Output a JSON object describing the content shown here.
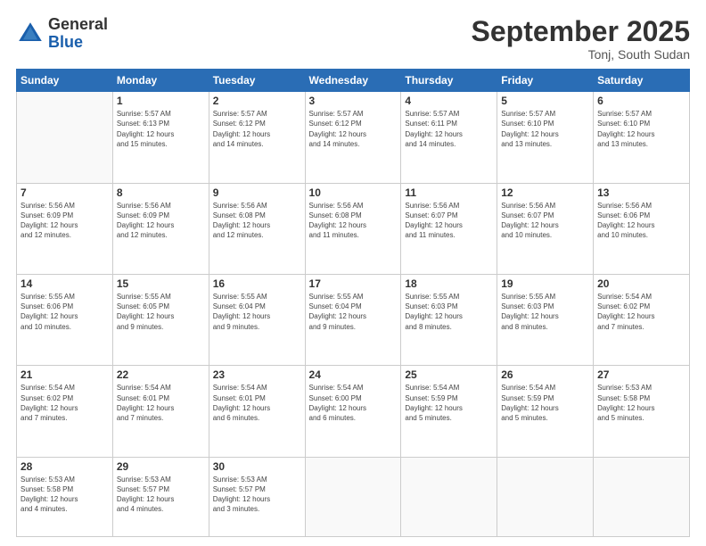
{
  "header": {
    "logo_general": "General",
    "logo_blue": "Blue",
    "title": "September 2025",
    "subtitle": "Tonj, South Sudan"
  },
  "weekdays": [
    "Sunday",
    "Monday",
    "Tuesday",
    "Wednesday",
    "Thursday",
    "Friday",
    "Saturday"
  ],
  "weeks": [
    [
      {
        "day": "",
        "info": ""
      },
      {
        "day": "1",
        "info": "Sunrise: 5:57 AM\nSunset: 6:13 PM\nDaylight: 12 hours\nand 15 minutes."
      },
      {
        "day": "2",
        "info": "Sunrise: 5:57 AM\nSunset: 6:12 PM\nDaylight: 12 hours\nand 14 minutes."
      },
      {
        "day": "3",
        "info": "Sunrise: 5:57 AM\nSunset: 6:12 PM\nDaylight: 12 hours\nand 14 minutes."
      },
      {
        "day": "4",
        "info": "Sunrise: 5:57 AM\nSunset: 6:11 PM\nDaylight: 12 hours\nand 14 minutes."
      },
      {
        "day": "5",
        "info": "Sunrise: 5:57 AM\nSunset: 6:10 PM\nDaylight: 12 hours\nand 13 minutes."
      },
      {
        "day": "6",
        "info": "Sunrise: 5:57 AM\nSunset: 6:10 PM\nDaylight: 12 hours\nand 13 minutes."
      }
    ],
    [
      {
        "day": "7",
        "info": "Sunrise: 5:56 AM\nSunset: 6:09 PM\nDaylight: 12 hours\nand 12 minutes."
      },
      {
        "day": "8",
        "info": "Sunrise: 5:56 AM\nSunset: 6:09 PM\nDaylight: 12 hours\nand 12 minutes."
      },
      {
        "day": "9",
        "info": "Sunrise: 5:56 AM\nSunset: 6:08 PM\nDaylight: 12 hours\nand 12 minutes."
      },
      {
        "day": "10",
        "info": "Sunrise: 5:56 AM\nSunset: 6:08 PM\nDaylight: 12 hours\nand 11 minutes."
      },
      {
        "day": "11",
        "info": "Sunrise: 5:56 AM\nSunset: 6:07 PM\nDaylight: 12 hours\nand 11 minutes."
      },
      {
        "day": "12",
        "info": "Sunrise: 5:56 AM\nSunset: 6:07 PM\nDaylight: 12 hours\nand 10 minutes."
      },
      {
        "day": "13",
        "info": "Sunrise: 5:56 AM\nSunset: 6:06 PM\nDaylight: 12 hours\nand 10 minutes."
      }
    ],
    [
      {
        "day": "14",
        "info": "Sunrise: 5:55 AM\nSunset: 6:06 PM\nDaylight: 12 hours\nand 10 minutes."
      },
      {
        "day": "15",
        "info": "Sunrise: 5:55 AM\nSunset: 6:05 PM\nDaylight: 12 hours\nand 9 minutes."
      },
      {
        "day": "16",
        "info": "Sunrise: 5:55 AM\nSunset: 6:04 PM\nDaylight: 12 hours\nand 9 minutes."
      },
      {
        "day": "17",
        "info": "Sunrise: 5:55 AM\nSunset: 6:04 PM\nDaylight: 12 hours\nand 9 minutes."
      },
      {
        "day": "18",
        "info": "Sunrise: 5:55 AM\nSunset: 6:03 PM\nDaylight: 12 hours\nand 8 minutes."
      },
      {
        "day": "19",
        "info": "Sunrise: 5:55 AM\nSunset: 6:03 PM\nDaylight: 12 hours\nand 8 minutes."
      },
      {
        "day": "20",
        "info": "Sunrise: 5:54 AM\nSunset: 6:02 PM\nDaylight: 12 hours\nand 7 minutes."
      }
    ],
    [
      {
        "day": "21",
        "info": "Sunrise: 5:54 AM\nSunset: 6:02 PM\nDaylight: 12 hours\nand 7 minutes."
      },
      {
        "day": "22",
        "info": "Sunrise: 5:54 AM\nSunset: 6:01 PM\nDaylight: 12 hours\nand 7 minutes."
      },
      {
        "day": "23",
        "info": "Sunrise: 5:54 AM\nSunset: 6:01 PM\nDaylight: 12 hours\nand 6 minutes."
      },
      {
        "day": "24",
        "info": "Sunrise: 5:54 AM\nSunset: 6:00 PM\nDaylight: 12 hours\nand 6 minutes."
      },
      {
        "day": "25",
        "info": "Sunrise: 5:54 AM\nSunset: 5:59 PM\nDaylight: 12 hours\nand 5 minutes."
      },
      {
        "day": "26",
        "info": "Sunrise: 5:54 AM\nSunset: 5:59 PM\nDaylight: 12 hours\nand 5 minutes."
      },
      {
        "day": "27",
        "info": "Sunrise: 5:53 AM\nSunset: 5:58 PM\nDaylight: 12 hours\nand 5 minutes."
      }
    ],
    [
      {
        "day": "28",
        "info": "Sunrise: 5:53 AM\nSunset: 5:58 PM\nDaylight: 12 hours\nand 4 minutes."
      },
      {
        "day": "29",
        "info": "Sunrise: 5:53 AM\nSunset: 5:57 PM\nDaylight: 12 hours\nand 4 minutes."
      },
      {
        "day": "30",
        "info": "Sunrise: 5:53 AM\nSunset: 5:57 PM\nDaylight: 12 hours\nand 3 minutes."
      },
      {
        "day": "",
        "info": ""
      },
      {
        "day": "",
        "info": ""
      },
      {
        "day": "",
        "info": ""
      },
      {
        "day": "",
        "info": ""
      }
    ]
  ]
}
